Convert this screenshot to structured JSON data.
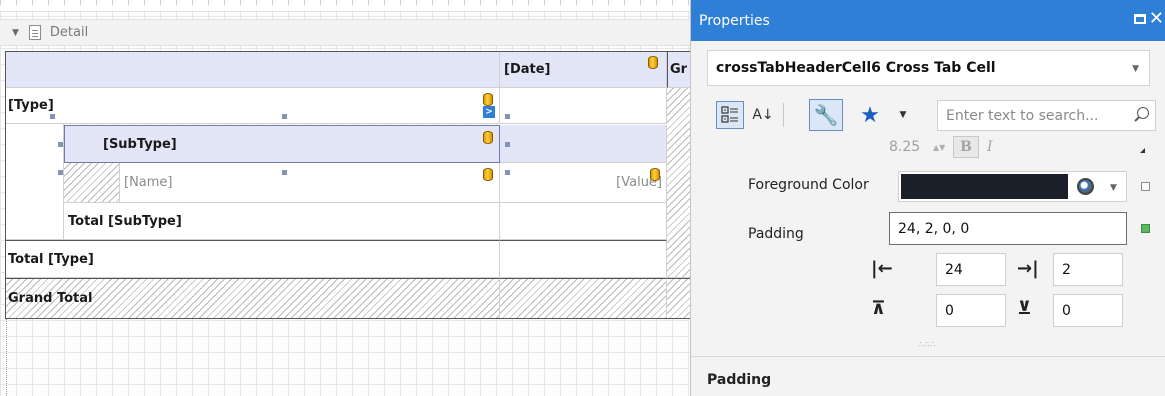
{
  "designer": {
    "band_label": "Detail",
    "cells": {
      "date_header": "[Date]",
      "grand_header": "Gr",
      "type": "[Type]",
      "subtype": "[SubType]",
      "name": "[Name]",
      "value": "[Value]",
      "total_subtype": "Total [SubType]",
      "total_type": "Total [Type]",
      "grand_total": "Grand Total"
    }
  },
  "properties": {
    "title": "Properties",
    "selected_object": "crossTabHeaderCell6  Cross Tab Cell",
    "search_placeholder": "Enter text to search...",
    "font_size": "8.25",
    "bold_label": "B",
    "italic_label": "I",
    "foreground_color_label": "Foreground Color",
    "foreground_color": "#1b1f2a",
    "padding_label": "Padding",
    "padding_value": "24, 2, 0, 0",
    "padding_left": "24",
    "padding_right": "2",
    "padding_top": "0",
    "padding_bottom": "0",
    "description_title": "Padding"
  },
  "colors": {
    "accent": "#2f7fd6",
    "header_cell_bg": "#e3e6f7",
    "reset_marker": "#5cb85c"
  }
}
